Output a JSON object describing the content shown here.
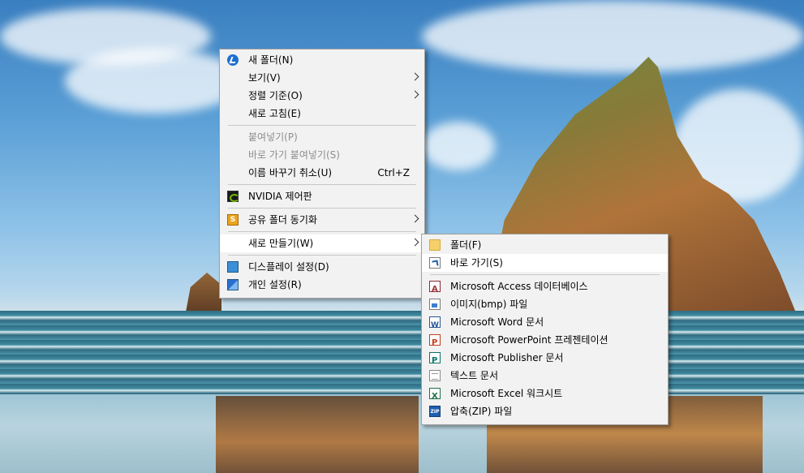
{
  "context_menu": {
    "items": [
      {
        "label": "새 폴더(N)",
        "icon": "new-folder-icon"
      },
      {
        "label": "보기(V)",
        "has_submenu": true
      },
      {
        "label": "정렬 기준(O)",
        "has_submenu": true
      },
      {
        "label": "새로 고침(E)"
      },
      {
        "label": "붙여넣기(P)",
        "disabled": true
      },
      {
        "label": "바로 가기 붙여넣기(S)",
        "disabled": true
      },
      {
        "label": "이름 바꾸기 취소(U)",
        "shortcut": "Ctrl+Z"
      },
      {
        "label": "NVIDIA 제어판",
        "icon": "nvidia-icon"
      },
      {
        "label": "공유 폴더 동기화",
        "icon": "sync-icon",
        "has_submenu": true
      },
      {
        "label": "새로 만들기(W)",
        "has_submenu": true,
        "highlighted": true
      },
      {
        "label": "디스플레이 설정(D)",
        "icon": "display-icon"
      },
      {
        "label": "개인 설정(R)",
        "icon": "personalize-icon"
      }
    ]
  },
  "new_submenu": {
    "items": [
      {
        "label": "폴더(F)",
        "icon": "folder-icon"
      },
      {
        "label": "바로 가기(S)",
        "icon": "shortcut-icon",
        "highlighted": true
      },
      {
        "label": "Microsoft Access 데이터베이스",
        "icon": "access-icon"
      },
      {
        "label": "이미지(bmp) 파일",
        "icon": "bitmap-icon"
      },
      {
        "label": "Microsoft Word 문서",
        "icon": "word-icon"
      },
      {
        "label": "Microsoft PowerPoint 프레젠테이션",
        "icon": "powerpoint-icon"
      },
      {
        "label": "Microsoft Publisher 문서",
        "icon": "publisher-icon"
      },
      {
        "label": "텍스트 문서",
        "icon": "text-document-icon"
      },
      {
        "label": "Microsoft Excel 워크시트",
        "icon": "excel-icon"
      },
      {
        "label": "압축(ZIP) 파일",
        "icon": "zip-icon"
      }
    ]
  },
  "icons": {
    "sync_glyph": "S",
    "zip_glyph": "ZIP"
  }
}
